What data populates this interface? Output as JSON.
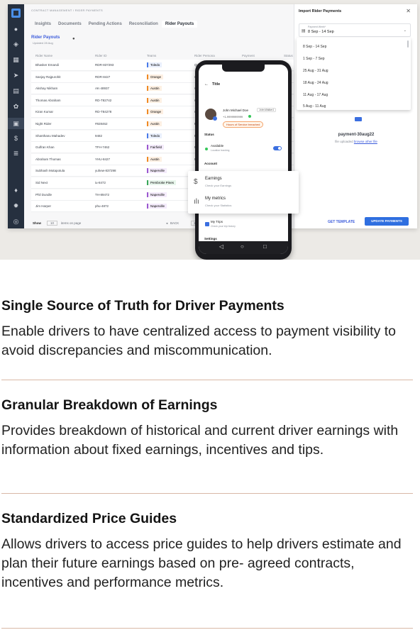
{
  "dashboard": {
    "breadcrumb": "CONTRACT MANAGEMENT / RIDER PAYMENTS",
    "tabs": [
      "Insights",
      "Documents",
      "Pending Actions",
      "Reconciliation",
      "Rider Payouts"
    ],
    "active_tab": "Rider Payouts",
    "payouts_title": "Rider Payouts",
    "payouts_updated": "Updated 28 Aug",
    "columns": [
      "Rider Name",
      "Rider ID",
      "Teams",
      "Rider Persona",
      "Payment",
      "Status"
    ],
    "rows": [
      {
        "name": "Bhasker Emandi",
        "id": "RDR-837293",
        "team": "Toledo",
        "persona": "Quick R"
      },
      {
        "name": "Sanjay Rajpurohit",
        "id": "RDR-8427",
        "team": "Orange",
        "persona": "Quick"
      },
      {
        "name": "Akshay Nikham",
        "id": "AK-48937",
        "team": "Austin",
        "persona": "Quick"
      },
      {
        "name": "Thomas Abraham",
        "id": "RD-T82742",
        "team": "Austin",
        "persona": "Quick"
      },
      {
        "name": "Kiran Kumar",
        "id": "RD-T84278",
        "team": "Orange",
        "persona": "Quick"
      },
      {
        "name": "Night Rider",
        "id": "#928462",
        "team": "Austin",
        "persona": "Rush"
      },
      {
        "name": "Shanthanu Mahadev",
        "id": "9482",
        "team": "Toledo",
        "persona": "Rush"
      },
      {
        "name": "Gulfran Khan",
        "id": "TFH-7462",
        "team": "Fairfield",
        "persona": "Rush"
      },
      {
        "name": "Abraham Thomas",
        "id": "YHU-8427",
        "team": "Austin",
        "persona": "Rush"
      },
      {
        "name": "Subhash Motapotula",
        "id": "yuhew-837298",
        "team": "Naperville",
        "persona": ""
      },
      {
        "name": "Sid Next",
        "id": "iu-8472",
        "team": "Pembroke Pines",
        "persona": ""
      },
      {
        "name": "Phil Dundle",
        "id": "TH-89472",
        "team": "Naperville",
        "persona": ""
      },
      {
        "name": "Jim Harper",
        "id": "phu-4872",
        "team": "Naperville",
        "persona": ""
      }
    ],
    "pager": {
      "show": "Show",
      "count": "10",
      "per_page": "items on page",
      "back": "BACK",
      "page": "1"
    }
  },
  "panel": {
    "title": "Import Rider Payments",
    "week_label": "Payment Week*",
    "week_value": "8 Sep - 14 Sep",
    "options": [
      "8 Sep - 14 Sep",
      "1 Sep - 7 Sep",
      "25 Aug - 31 Aug",
      "18 Aug - 24 Aug",
      "11 Aug - 17 Aug",
      "5 Aug - 11 Aug"
    ],
    "file_name": "payment-30aug22",
    "file_uploaded": "file uploaded",
    "browse": "browse other file",
    "get_template": "GET TEMPLATE",
    "update": "UPDATE PAYMENTS"
  },
  "phone": {
    "title": "Title",
    "name": "John Michael Doe",
    "tag": "John.Walker1",
    "phone_number": "+1-9999999999",
    "warning": "Hours of Service breached",
    "status_heading": "Status",
    "available": "Available",
    "available_sub": "Location tracking",
    "account_heading": "Account",
    "my_trips": "My Trips",
    "my_trips_sub": "Check your trip history",
    "settings_heading": "Settings"
  },
  "popcard": {
    "earnings": "Earnings",
    "earnings_sub": "Check your Earnings",
    "metrics": "My metrics",
    "metrics_sub": "Check your Statistics"
  },
  "sections": [
    {
      "title": "Single Source of Truth for Driver Payments",
      "body": "Enable drivers to have centralized access to payment visibility to avoid discrepancies and  miscommunication."
    },
    {
      "title": "Granular Breakdown of Earnings",
      "body": "Provides breakdown of historical and current driver earnings with information about fixed  earnings, incentives and tips."
    },
    {
      "title": "Standardized Price Guides",
      "body": "Allows drivers to access price guides to help drivers estimate and plan their future earnings based on pre- agreed contracts, incentives and performance metrics."
    }
  ],
  "colors": {
    "team_orange": "#f08a24",
    "team_blue": "#4a7be8",
    "team_purple": "#9b59d0",
    "team_green": "#3aa65a",
    "divider": "#d9b8a6",
    "accent": "#2f6fe0"
  }
}
